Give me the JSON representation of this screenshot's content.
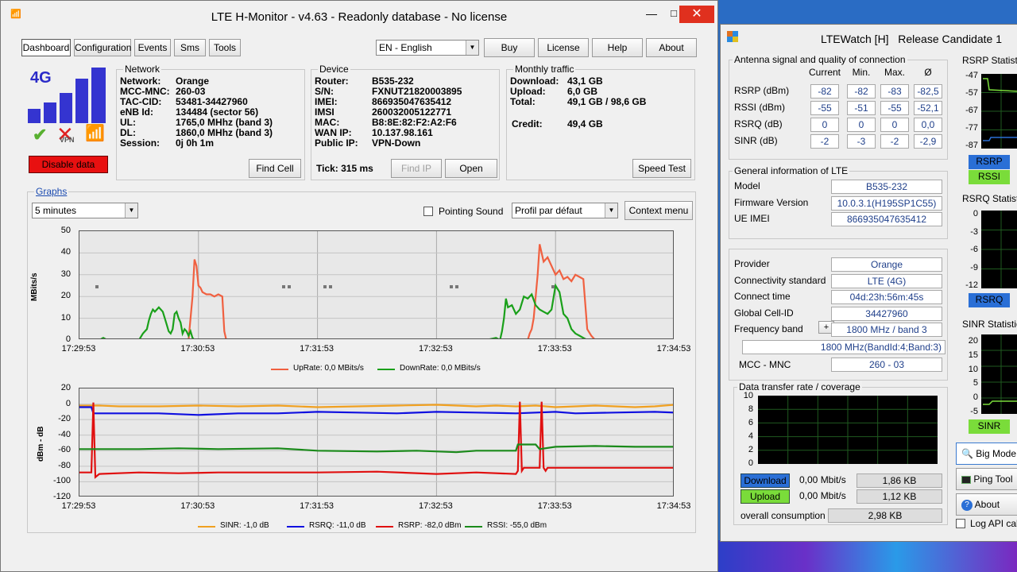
{
  "main_window": {
    "title": "LTE H-Monitor - v4.63 - Readonly database - No license",
    "tabs": [
      "Dashboard",
      "Configuration",
      "Events",
      "Sms",
      "Tools"
    ],
    "language": "EN - English",
    "buttons": {
      "buy": "Buy",
      "license": "License",
      "help": "Help",
      "about": "About"
    }
  },
  "status": {
    "generation": "4G",
    "vpn_label": "VPN",
    "disable_data": "Disable data"
  },
  "network": {
    "title": "Network",
    "rows": [
      {
        "k": "Network:",
        "v": "Orange"
      },
      {
        "k": "MCC-MNC:",
        "v": "260-03"
      },
      {
        "k": "TAC-CID:",
        "v": "53481-34427960"
      },
      {
        "k": "eNB Id:",
        "v": "134484 (sector 56)"
      },
      {
        "k": "UL:",
        "v": "1765,0 MHhz (band 3)"
      },
      {
        "k": "DL:",
        "v": "1860,0 MHhz (band 3)"
      },
      {
        "k": "Session:",
        "v": "0j 0h 1m"
      }
    ],
    "find_cell": "Find Cell"
  },
  "device": {
    "title": "Device",
    "rows": [
      {
        "k": "Router:",
        "v": "B535-232"
      },
      {
        "k": "S/N:",
        "v": "FXNUT21820003895"
      },
      {
        "k": "IMEI:",
        "v": "866935047635412"
      },
      {
        "k": "IMSI",
        "v": "260032005122771"
      },
      {
        "k": "MAC:",
        "v": "B8:8E:82:F2:A2:F6"
      },
      {
        "k": "WAN IP:",
        "v": "10.137.98.161"
      },
      {
        "k": "Public IP:",
        "v": "VPN-Down"
      }
    ],
    "tick": "Tick: 315 ms",
    "find_ip": "Find IP",
    "open": "Open"
  },
  "traffic": {
    "title": "Monthly traffic",
    "rows": [
      {
        "k": "Download:",
        "v": "43,1 GB"
      },
      {
        "k": "Upload:",
        "v": "6,0 GB"
      },
      {
        "k": "Total:",
        "v": "49,1 GB / 98,6 GB"
      }
    ],
    "credit_k": "Credit:",
    "credit_v": "49,4 GB",
    "speed_test": "Speed Test"
  },
  "graphs": {
    "title": "Graphs",
    "period": "5 minutes",
    "pointing_sound": "Pointing Sound",
    "profile": "Profil par défaut",
    "context_menu": "Context menu"
  },
  "chart_data": [
    {
      "type": "line",
      "ylabel": "MBits/s",
      "ylim": [
        0,
        50
      ],
      "yticks": [
        "50",
        "40",
        "30",
        "20",
        "10",
        "0"
      ],
      "xticks": [
        "17:29:53",
        "17:30:53",
        "17:31:53",
        "17:32:53",
        "17:33:53",
        "17:34:53"
      ],
      "grid": true,
      "series": [
        {
          "name": "UpRate: 0,0 MBits/s",
          "color": "#f06040",
          "x": [
            0,
            40,
            50,
            55,
            57,
            58,
            59,
            60,
            61,
            62,
            64,
            66,
            68,
            70,
            72,
            73,
            74,
            220,
            222,
            224,
            226,
            227,
            228,
            229,
            230,
            231,
            232,
            234,
            236,
            238,
            240,
            242,
            244,
            246,
            248,
            250,
            252,
            254,
            256,
            258,
            260,
            262,
            264,
            266,
            268,
            270,
            272,
            274,
            276,
            278,
            280,
            282,
            284,
            286,
            287,
            288,
            300
          ],
          "y": [
            0,
            0,
            0,
            0,
            20,
            37,
            34,
            25,
            24,
            22,
            21,
            21,
            20,
            21,
            20,
            4,
            0,
            0,
            0,
            0,
            0,
            3,
            5,
            10,
            20,
            30,
            44,
            36,
            38,
            34,
            30,
            32,
            28,
            29,
            27,
            30,
            29,
            28,
            5,
            2,
            0,
            0,
            0,
            0,
            0,
            0,
            0,
            0,
            0,
            0,
            0,
            0,
            0,
            0,
            0,
            0,
            0
          ]
        },
        {
          "name": "DownRate: 0,0 MBits/s",
          "color": "#1aa01a",
          "x": [
            0,
            10,
            12,
            14,
            20,
            30,
            32,
            34,
            35,
            36,
            37,
            38,
            39,
            40,
            41,
            42,
            43,
            44,
            45,
            46,
            47,
            48,
            49,
            50,
            51,
            52,
            53,
            54,
            55,
            56,
            57,
            58,
            60,
            200,
            205,
            210,
            212,
            213,
            214,
            215,
            216,
            218,
            220,
            222,
            224,
            226,
            228,
            230,
            232,
            234,
            236,
            238,
            240,
            242,
            244,
            246,
            248,
            250,
            252,
            254,
            256,
            258,
            300
          ],
          "y": [
            0,
            0,
            1,
            0,
            0,
            0,
            3,
            5,
            9,
            12,
            14,
            13,
            14,
            15,
            14,
            13,
            10,
            7,
            4,
            3,
            5,
            12,
            13,
            10,
            8,
            3,
            5,
            4,
            2,
            4,
            1,
            0,
            0,
            0,
            0,
            1,
            0,
            4,
            10,
            19,
            15,
            16,
            12,
            14,
            20,
            19,
            21,
            16,
            14,
            13,
            12,
            14,
            25,
            22,
            12,
            10,
            5,
            3,
            2,
            1,
            0,
            0,
            0
          ]
        }
      ]
    },
    {
      "type": "line",
      "ylabel": "dBm - dB",
      "ylim": [
        -120,
        20
      ],
      "yticks": [
        "20",
        "0",
        "-20",
        "-40",
        "-60",
        "-80",
        "-100",
        "-120"
      ],
      "xticks": [
        "17:29:53",
        "17:30:53",
        "17:31:53",
        "17:32:53",
        "17:33:53",
        "17:34:53"
      ],
      "grid": true,
      "series": [
        {
          "name": "SINR: -1,0 dB",
          "color": "#f0a020",
          "x": [
            0,
            10,
            20,
            40,
            60,
            80,
            100,
            120,
            140,
            160,
            180,
            200,
            210,
            220,
            230,
            240,
            250,
            260,
            270,
            280,
            290,
            300
          ],
          "y": [
            -2,
            -2,
            -3,
            -3,
            -2,
            -3,
            -2,
            -4,
            -3,
            -2,
            -1,
            -3,
            -2,
            -3,
            -2,
            -4,
            -3,
            -2,
            -3,
            -4,
            -3,
            -1
          ]
        },
        {
          "name": "RSRQ: -11,0 dB",
          "color": "#1010e0",
          "x": [
            0,
            6,
            7,
            20,
            40,
            60,
            80,
            100,
            120,
            140,
            160,
            180,
            200,
            220,
            240,
            250,
            270,
            290,
            300
          ],
          "y": [
            -4,
            -4,
            -12,
            -12,
            -12,
            -14,
            -12,
            -12,
            -10,
            -11,
            -12,
            -10,
            -11,
            -12,
            -10,
            -12,
            -11,
            -10,
            -11
          ]
        },
        {
          "name": "RSRP: -82,0 dBm",
          "color": "#e01010",
          "x": [
            0,
            6,
            7,
            8,
            10,
            30,
            50,
            70,
            100,
            120,
            150,
            180,
            200,
            220,
            221,
            222,
            223,
            224,
            232,
            233,
            234,
            235,
            236,
            250,
            300
          ],
          "y": [
            -88,
            -88,
            2,
            -94,
            -90,
            -88,
            -89,
            -88,
            -88,
            -88,
            -87,
            -90,
            -88,
            -90,
            -86,
            3,
            -86,
            -82,
            -82,
            3,
            -82,
            -86,
            -82,
            -82,
            -82
          ]
        },
        {
          "name": "RSSI: -55,0 dBm",
          "color": "#1a8a1a",
          "x": [
            0,
            10,
            30,
            50,
            70,
            100,
            120,
            150,
            170,
            190,
            200,
            220,
            221,
            230,
            232,
            240,
            260,
            280,
            300
          ],
          "y": [
            -58,
            -58,
            -58,
            -57,
            -58,
            -57,
            -60,
            -61,
            -60,
            -62,
            -60,
            -60,
            -52,
            -52,
            -58,
            -55,
            -54,
            -55,
            -55
          ]
        }
      ]
    }
  ],
  "ltewatch": {
    "title": "LTEWatch [H]   Release Candidate 1",
    "antenna_title": "Antenna signal and quality of connection",
    "headers": [
      "Current",
      "Min.",
      "Max.",
      "Ø"
    ],
    "rows": [
      {
        "label": "RSRP (dBm)",
        "vals": [
          "-82",
          "-82",
          "-83",
          "-82,5"
        ]
      },
      {
        "label": "RSSI (dBm)",
        "vals": [
          "-55",
          "-51",
          "-55",
          "-52,1"
        ]
      },
      {
        "label": "RSRQ (dB)",
        "vals": [
          "0",
          "0",
          "0",
          "0,0"
        ]
      },
      {
        "label": "SINR (dB)",
        "vals": [
          "-2",
          "-3",
          "-2",
          "-2,9"
        ]
      }
    ],
    "general_title": "General information of LTE",
    "general": [
      {
        "label": "Model",
        "value": "B535-232"
      },
      {
        "label": "Firmware Version",
        "value": "10.0.3.1(H195SP1C55)"
      },
      {
        "label": "UE IMEI",
        "value": "866935047635412"
      }
    ],
    "provider": [
      {
        "label": "Provider",
        "value": "Orange"
      },
      {
        "label": "Connectivity standard",
        "value": "LTE (4G)"
      },
      {
        "label": "Connect time",
        "value": "04d:23h:56m:45s"
      },
      {
        "label": "Global Cell-ID",
        "value": "34427960"
      },
      {
        "label": "Frequency band",
        "value": "1800 MHz / band 3"
      }
    ],
    "band_detail": "1800 MHz(BandId:4;Band:3)",
    "mcc_label": "MCC - MNC",
    "mcc_value": "260 - 03",
    "transfer_title": "Data transfer rate / coverage",
    "transfer_yticks": [
      "10",
      "8",
      "6",
      "4",
      "2",
      "0"
    ],
    "download_label": "Download",
    "download_rate": "0,00 Mbit/s",
    "download_total": "1,86 KB",
    "upload_label": "Upload",
    "upload_rate": "0,00 Mbit/s",
    "upload_total": "1,12 KB",
    "overall_label": "overall consumption",
    "overall_value": "2,98 KB",
    "rsrp_stats_title": "RSRP Statistic",
    "rsrp_ticks": [
      "-47",
      "-57",
      "-67",
      "-77",
      "-87"
    ],
    "rsrp_tag": "RSRP",
    "rssi_tag": "RSSI",
    "rsrq_stats_title": "RSRQ Statistic",
    "rsrq_ticks": [
      "0",
      "-3",
      "-6",
      "-9",
      "-12"
    ],
    "rsrq_tag": "RSRQ",
    "sinr_stats_title": "SINR Statistics",
    "sinr_ticks": [
      "20",
      "15",
      "10",
      "5",
      "0",
      "-5"
    ],
    "sinr_tag": "SINR",
    "big_mode": "Big Mode",
    "ping_tool": "Ping Tool",
    "about": "About",
    "log_api": "Log API calls"
  },
  "colors": {
    "download": "#2a6fd6",
    "upload": "#7adc3a",
    "rsrp": "#2a6fd6",
    "rssi": "#7adc3a",
    "disable": "#e81010"
  }
}
